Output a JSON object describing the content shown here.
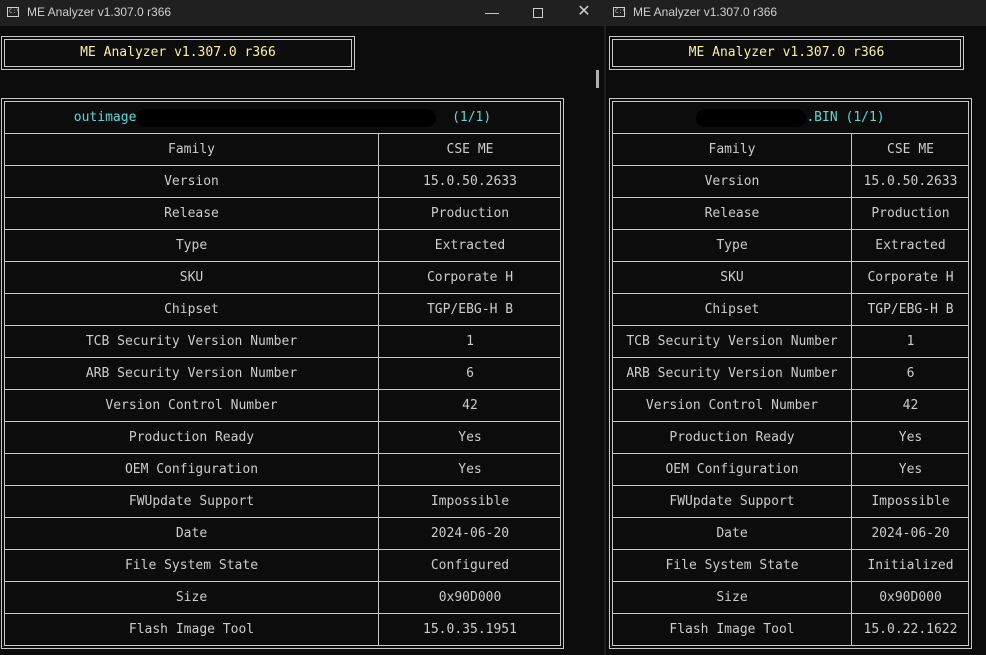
{
  "left_window": {
    "title": "ME Analyzer v1.307.0 r366",
    "header": "ME Analyzer v1.307.0 r366",
    "file_name_prefix": "outimage",
    "file_suffix": "(1/1)",
    "rows": [
      {
        "label": "Family",
        "value": "CSE ME"
      },
      {
        "label": "Version",
        "value": "15.0.50.2633"
      },
      {
        "label": "Release",
        "value": "Production"
      },
      {
        "label": "Type",
        "value": "Extracted"
      },
      {
        "label": "SKU",
        "value": "Corporate H"
      },
      {
        "label": "Chipset",
        "value": "TGP/EBG-H B"
      },
      {
        "label": "TCB Security Version Number",
        "value": "1"
      },
      {
        "label": "ARB Security Version Number",
        "value": "6"
      },
      {
        "label": "Version Control Number",
        "value": "42"
      },
      {
        "label": "Production Ready",
        "value": "Yes"
      },
      {
        "label": "OEM Configuration",
        "value": "Yes"
      },
      {
        "label": "FWUpdate Support",
        "value": "Impossible"
      },
      {
        "label": "Date",
        "value": "2024-06-20"
      },
      {
        "label": "File System State",
        "value": "Configured"
      },
      {
        "label": "Size",
        "value": "0x90D000"
      },
      {
        "label": "Flash Image Tool",
        "value": "15.0.35.1951"
      }
    ]
  },
  "right_window": {
    "title": "ME Analyzer v1.307.0 r366",
    "header": "ME Analyzer v1.307.0 r366",
    "file_suffix": ".BIN (1/1)",
    "rows": [
      {
        "label": "Family",
        "value": "CSE ME"
      },
      {
        "label": "Version",
        "value": "15.0.50.2633"
      },
      {
        "label": "Release",
        "value": "Production"
      },
      {
        "label": "Type",
        "value": "Extracted"
      },
      {
        "label": "SKU",
        "value": "Corporate H"
      },
      {
        "label": "Chipset",
        "value": "TGP/EBG-H B"
      },
      {
        "label": "TCB Security Version Number",
        "value": "1"
      },
      {
        "label": "ARB Security Version Number",
        "value": "6"
      },
      {
        "label": "Version Control Number",
        "value": "42"
      },
      {
        "label": "Production Ready",
        "value": "Yes"
      },
      {
        "label": "OEM Configuration",
        "value": "Yes"
      },
      {
        "label": "FWUpdate Support",
        "value": "Impossible"
      },
      {
        "label": "Date",
        "value": "2024-06-20"
      },
      {
        "label": "File System State",
        "value": "Initialized"
      },
      {
        "label": "Size",
        "value": "0x90D000"
      },
      {
        "label": "Flash Image Tool",
        "value": "15.0.22.1622"
      }
    ]
  },
  "icons": {
    "app": "console-icon",
    "minimize": "minimize-icon",
    "maximize": "maximize-icon",
    "close": "close-icon"
  },
  "colors": {
    "background": "#0c0c0c",
    "titlebar": "#202020",
    "header_text": "#f9f1a5",
    "filename_text": "#61d6d6",
    "table_text": "#cccccc",
    "border": "#c8c8c8"
  }
}
